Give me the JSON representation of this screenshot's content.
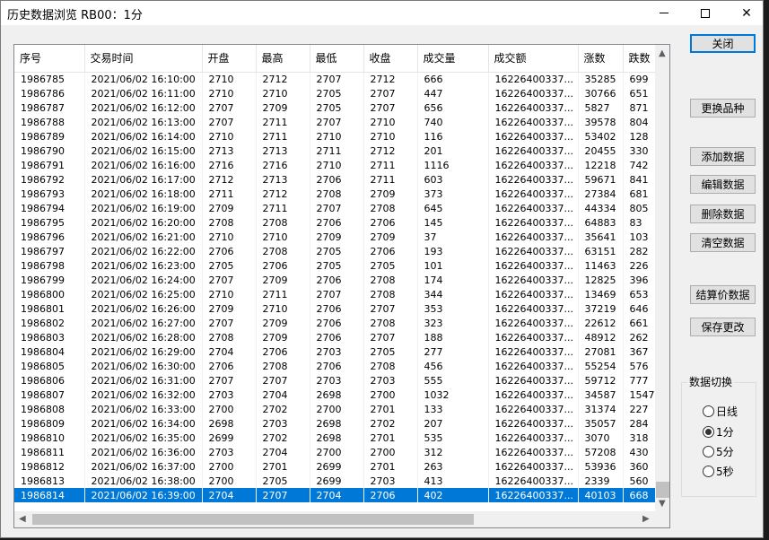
{
  "window": {
    "title": "历史数据浏览 RB00：1分"
  },
  "columns": [
    "序号",
    "交易时间",
    "开盘",
    "最高",
    "最低",
    "收盘",
    "成交量",
    "成交额",
    "涨数",
    "跌数"
  ],
  "rows": [
    [
      "1986785",
      "2021/06/02  16:10:00",
      "2710",
      "2712",
      "2707",
      "2712",
      "666",
      "16226400337...",
      "35285",
      "699"
    ],
    [
      "1986786",
      "2021/06/02  16:11:00",
      "2710",
      "2710",
      "2705",
      "2707",
      "447",
      "16226400337...",
      "30766",
      "651"
    ],
    [
      "1986787",
      "2021/06/02  16:12:00",
      "2707",
      "2709",
      "2705",
      "2707",
      "656",
      "16226400337...",
      "5827",
      "871"
    ],
    [
      "1986788",
      "2021/06/02  16:13:00",
      "2707",
      "2711",
      "2707",
      "2710",
      "740",
      "16226400337...",
      "39578",
      "804"
    ],
    [
      "1986789",
      "2021/06/02  16:14:00",
      "2710",
      "2711",
      "2710",
      "2710",
      "116",
      "16226400337...",
      "53402",
      "128"
    ],
    [
      "1986790",
      "2021/06/02  16:15:00",
      "2713",
      "2713",
      "2711",
      "2712",
      "201",
      "16226400337...",
      "20455",
      "330"
    ],
    [
      "1986791",
      "2021/06/02  16:16:00",
      "2716",
      "2716",
      "2710",
      "2711",
      "1116",
      "16226400337...",
      "12218",
      "742"
    ],
    [
      "1986792",
      "2021/06/02  16:17:00",
      "2712",
      "2713",
      "2706",
      "2711",
      "603",
      "16226400337...",
      "59671",
      "841"
    ],
    [
      "1986793",
      "2021/06/02  16:18:00",
      "2711",
      "2712",
      "2708",
      "2709",
      "373",
      "16226400337...",
      "27384",
      "681"
    ],
    [
      "1986794",
      "2021/06/02  16:19:00",
      "2709",
      "2711",
      "2707",
      "2708",
      "645",
      "16226400337...",
      "44334",
      "805"
    ],
    [
      "1986795",
      "2021/06/02  16:20:00",
      "2708",
      "2708",
      "2706",
      "2706",
      "145",
      "16226400337...",
      "64883",
      "83"
    ],
    [
      "1986796",
      "2021/06/02  16:21:00",
      "2710",
      "2710",
      "2709",
      "2709",
      "37",
      "16226400337...",
      "35641",
      "103"
    ],
    [
      "1986797",
      "2021/06/02  16:22:00",
      "2706",
      "2708",
      "2705",
      "2706",
      "193",
      "16226400337...",
      "63151",
      "282"
    ],
    [
      "1986798",
      "2021/06/02  16:23:00",
      "2705",
      "2706",
      "2705",
      "2705",
      "101",
      "16226400337...",
      "11463",
      "226"
    ],
    [
      "1986799",
      "2021/06/02  16:24:00",
      "2707",
      "2709",
      "2706",
      "2708",
      "174",
      "16226400337...",
      "12825",
      "396"
    ],
    [
      "1986800",
      "2021/06/02  16:25:00",
      "2710",
      "2711",
      "2707",
      "2708",
      "344",
      "16226400337...",
      "13469",
      "653"
    ],
    [
      "1986801",
      "2021/06/02  16:26:00",
      "2709",
      "2710",
      "2706",
      "2707",
      "353",
      "16226400337...",
      "37219",
      "646"
    ],
    [
      "1986802",
      "2021/06/02  16:27:00",
      "2707",
      "2709",
      "2706",
      "2708",
      "323",
      "16226400337...",
      "22612",
      "661"
    ],
    [
      "1986803",
      "2021/06/02  16:28:00",
      "2708",
      "2709",
      "2706",
      "2707",
      "188",
      "16226400337...",
      "48912",
      "262"
    ],
    [
      "1986804",
      "2021/06/02  16:29:00",
      "2704",
      "2706",
      "2703",
      "2705",
      "277",
      "16226400337...",
      "27081",
      "367"
    ],
    [
      "1986805",
      "2021/06/02  16:30:00",
      "2706",
      "2708",
      "2706",
      "2708",
      "456",
      "16226400337...",
      "55254",
      "576"
    ],
    [
      "1986806",
      "2021/06/02  16:31:00",
      "2707",
      "2707",
      "2703",
      "2703",
      "555",
      "16226400337...",
      "59712",
      "777"
    ],
    [
      "1986807",
      "2021/06/02  16:32:00",
      "2703",
      "2704",
      "2698",
      "2700",
      "1032",
      "16226400337...",
      "34587",
      "1547"
    ],
    [
      "1986808",
      "2021/06/02  16:33:00",
      "2700",
      "2702",
      "2700",
      "2701",
      "133",
      "16226400337...",
      "31374",
      "227"
    ],
    [
      "1986809",
      "2021/06/02  16:34:00",
      "2698",
      "2703",
      "2698",
      "2702",
      "207",
      "16226400337...",
      "35057",
      "284"
    ],
    [
      "1986810",
      "2021/06/02  16:35:00",
      "2699",
      "2702",
      "2698",
      "2701",
      "535",
      "16226400337...",
      "3070",
      "318"
    ],
    [
      "1986811",
      "2021/06/02  16:36:00",
      "2703",
      "2704",
      "2700",
      "2700",
      "312",
      "16226400337...",
      "57208",
      "430"
    ],
    [
      "1986812",
      "2021/06/02  16:37:00",
      "2700",
      "2701",
      "2699",
      "2701",
      "263",
      "16226400337...",
      "53936",
      "360"
    ],
    [
      "1986813",
      "2021/06/02  16:38:00",
      "2700",
      "2705",
      "2699",
      "2703",
      "413",
      "16226400337...",
      "2339",
      "560"
    ],
    [
      "1986814",
      "2021/06/02  16:39:00",
      "2704",
      "2707",
      "2704",
      "2706",
      "402",
      "16226400337...",
      "40103",
      "668"
    ]
  ],
  "selected_row_index": 29,
  "buttons": {
    "close": "关闭",
    "change_symbol": "更换品种",
    "add": "添加数据",
    "edit": "编辑数据",
    "delete": "删除数据",
    "clear": "清空数据",
    "settlement": "结算价数据",
    "save": "保存更改"
  },
  "data_switch": {
    "title": "数据切换",
    "options": [
      "日线",
      "1分",
      "5分",
      "5秒"
    ],
    "selected_index": 1
  },
  "colors": {
    "selection": "#0078d7",
    "default_button_border": "#0078d7"
  }
}
